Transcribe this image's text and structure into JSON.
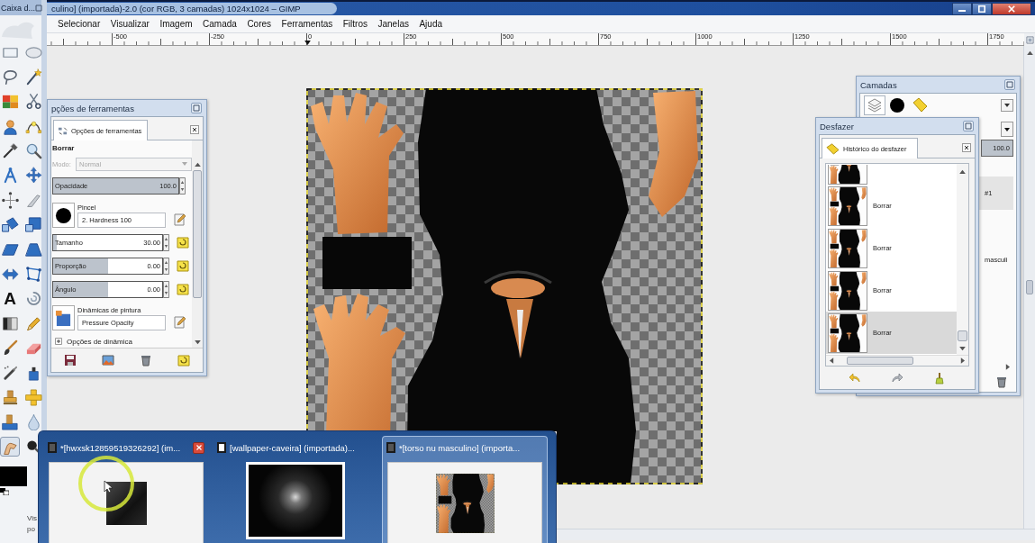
{
  "title_bar": {
    "toolbox_title": "Caixa d...",
    "title": "culino] (importada)-2.0 (cor RGB, 3 camadas) 1024x1024 – GIMP"
  },
  "menu": [
    "Selecionar",
    "Visualizar",
    "Imagem",
    "Camada",
    "Cores",
    "Ferramentas",
    "Filtros",
    "Janelas",
    "Ajuda"
  ],
  "ruler": {
    "labels": [
      "-500",
      "-250",
      "0",
      "250",
      "500",
      "750",
      "1000",
      "1250",
      "1500",
      "1750"
    ]
  },
  "toolbox": {
    "tools": [
      {
        "selected": false
      },
      {
        "selected": false
      },
      {
        "selected": false
      },
      {
        "selected": false
      },
      {
        "selected": false
      },
      {
        "selected": false
      },
      {
        "selected": false
      },
      {
        "selected": false
      },
      {
        "selected": false
      },
      {
        "selected": false
      },
      {
        "selected": false
      },
      {
        "selected": false
      },
      {
        "selected": false
      },
      {
        "selected": false
      },
      {
        "selected": false
      },
      {
        "selected": false
      },
      {
        "selected": false
      },
      {
        "selected": false
      },
      {
        "selected": false
      },
      {
        "selected": false
      },
      {
        "selected": false,
        "glyph": "A"
      },
      {
        "selected": false
      },
      {
        "selected": false
      },
      {
        "selected": false
      },
      {
        "selected": false
      },
      {
        "selected": false
      },
      {
        "selected": false
      },
      {
        "selected": false
      },
      {
        "selected": false
      },
      {
        "selected": false
      },
      {
        "selected": false
      },
      {
        "selected": false
      },
      {
        "selected": true
      },
      {
        "selected": false
      }
    ],
    "hint_lines": [
      "Vis",
      "po"
    ]
  },
  "tool_options": {
    "title": "pções de ferramentas",
    "tab": "Opções de ferramentas",
    "tool_name": "Borrar",
    "mode": {
      "label": "Modo:",
      "value": "Normal",
      "disabled": true
    },
    "opacity": {
      "label": "Opacidade",
      "value": "100.0",
      "level": 1
    },
    "brush": {
      "label": "Pincel",
      "value": "2. Hardness 100"
    },
    "sliders": [
      {
        "label": "Tamanho",
        "value": "30.00",
        "level": 0.03
      },
      {
        "label": "Proporção",
        "value": "0.00",
        "level": 0.5
      },
      {
        "label": "Ângulo",
        "value": "0.00",
        "level": 0.5
      }
    ],
    "dynamics": {
      "label": "Dinâmicas de pintura",
      "value": "Pressure Opacity"
    },
    "dynamics_options": {
      "label": "Opções de dinâmica",
      "expanded": false
    }
  },
  "layers": {
    "title": "Camadas",
    "tabs": [
      {
        "selected": true
      },
      {
        "selected": false
      },
      {
        "selected": false
      }
    ],
    "opacity": {
      "value": "100.0",
      "level": 1
    },
    "rows": [
      {
        "name": "#1",
        "selected": true
      },
      {
        "selected": false
      },
      {
        "name": "masculi",
        "selected": false
      }
    ]
  },
  "undo": {
    "title": "Desfazer",
    "tab": "Histórico do desfazer",
    "rows": [
      {
        "selected": false
      },
      {
        "label": "Borrar",
        "selected": false
      },
      {
        "label": "Borrar",
        "selected": false
      },
      {
        "label": "Borrar",
        "selected": false
      },
      {
        "label": "Borrar",
        "selected": true
      }
    ]
  },
  "taskbar_previews": [
    {
      "title": "*[hwxsk12859519326292] (im...",
      "kind": "photo",
      "selected": false,
      "hovered": true
    },
    {
      "title": "[wallpaper-caveira] (importada)...",
      "kind": "dark_image",
      "selected": false,
      "hovered": false
    },
    {
      "title": "*[torso nu masculino] (importa...",
      "kind": "texture",
      "selected": true,
      "hovered": false
    }
  ]
}
